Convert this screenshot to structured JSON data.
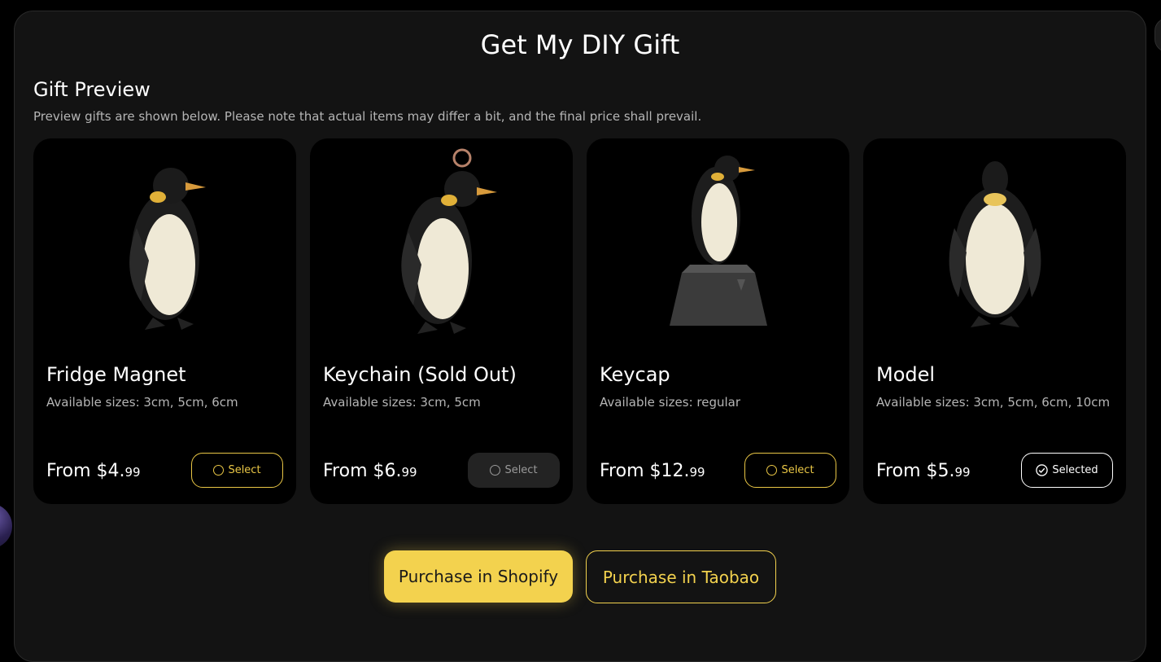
{
  "page": {
    "title": "Get My DIY Gift"
  },
  "preview": {
    "title": "Gift Preview",
    "description": "Preview gifts are shown below. Please note that actual items may differ a bit, and the final price shall prevail."
  },
  "products": [
    {
      "name": "Fridge Magnet",
      "sizes": "Available sizes: 3cm, 5cm, 6cm",
      "price_main": "From $4.",
      "price_cents": "99",
      "button_label": "Select",
      "state": "default",
      "image": "penguin-magnet"
    },
    {
      "name": "Keychain (Sold Out)",
      "sizes": "Available sizes: 3cm, 5cm",
      "price_main": "From $6.",
      "price_cents": "99",
      "button_label": "Select",
      "state": "disabled",
      "image": "penguin-keychain"
    },
    {
      "name": "Keycap",
      "sizes": "Available sizes: regular",
      "price_main": "From $12.",
      "price_cents": "99",
      "button_label": "Select",
      "state": "default",
      "image": "penguin-keycap"
    },
    {
      "name": "Model",
      "sizes": "Available sizes: 3cm, 5cm, 6cm, 10cm",
      "price_main": "From $5.",
      "price_cents": "99",
      "button_label": "Selected",
      "state": "selected",
      "image": "penguin-model"
    }
  ],
  "actions": {
    "shopify": "Purchase in Shopify",
    "taobao": "Purchase in Taobao"
  },
  "colors": {
    "accent": "#f3d24e",
    "panel": "#131313",
    "card": "#000000"
  }
}
